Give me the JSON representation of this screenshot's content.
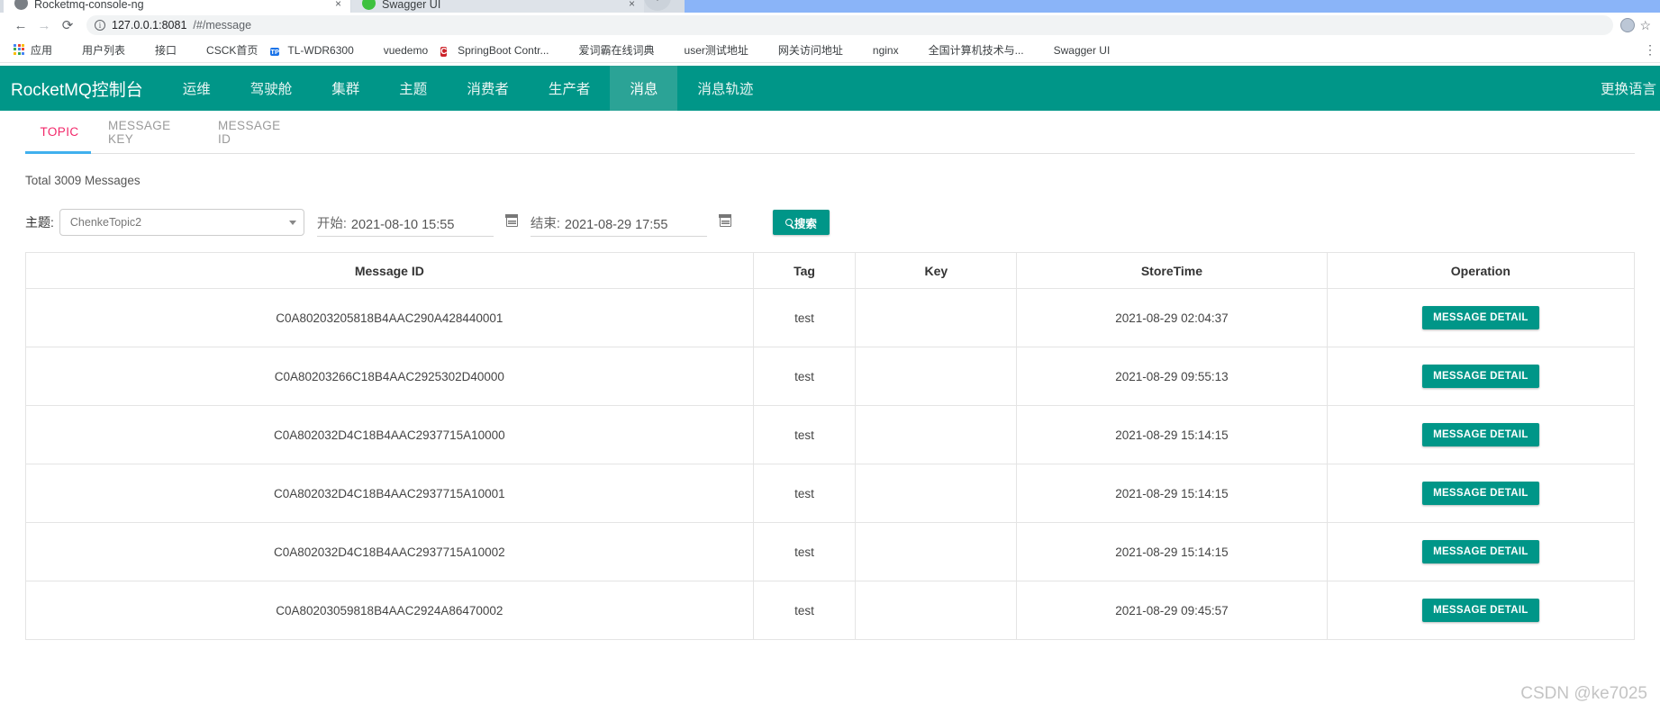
{
  "browser": {
    "tabs": [
      {
        "title": "Rocketmq-console-ng",
        "favicon": "globe-icon",
        "active": false,
        "close_label": "×"
      },
      {
        "title": "Swagger UI",
        "favicon": "swagger-icon",
        "active": true,
        "close_label": "×"
      }
    ],
    "new_tab_label": "+",
    "back_label": "←",
    "forward_label": "→",
    "reload_label": "⟳",
    "address": {
      "host": "127.0.0.1:8081",
      "path": "/#/message",
      "info_icon": "ⓘ"
    },
    "star_label": "☆",
    "bookmarks": [
      {
        "label": "应用",
        "icon": "apps-grid-icon"
      },
      {
        "label": "用户列表",
        "icon": "leaf-icon"
      },
      {
        "label": "接口",
        "icon": "leaf-icon"
      },
      {
        "label": "CSCK首页",
        "icon": "leaf-icon"
      },
      {
        "label": "TL-WDR6300",
        "icon": "tp-icon"
      },
      {
        "label": "vuedemo",
        "icon": "globe-icon"
      },
      {
        "label": "SpringBoot Contr...",
        "icon": "c-icon"
      },
      {
        "label": "爱词霸在线词典",
        "icon": "globe-icon"
      },
      {
        "label": "user测试地址",
        "icon": "leaf-icon"
      },
      {
        "label": "网关访问地址",
        "icon": "globe-icon"
      },
      {
        "label": "nginx",
        "icon": "globe-icon"
      },
      {
        "label": "全国计算机技术与...",
        "icon": "dark-badge-icon"
      },
      {
        "label": "Swagger UI",
        "icon": "swagger-icon"
      }
    ],
    "bookmarks_overflow_label": "⋮"
  },
  "app": {
    "brand": "RocketMQ控制台",
    "nav_items": [
      {
        "label": "运维",
        "active": false
      },
      {
        "label": "驾驶舱",
        "active": false
      },
      {
        "label": "集群",
        "active": false
      },
      {
        "label": "主题",
        "active": false
      },
      {
        "label": "消费者",
        "active": false
      },
      {
        "label": "生产者",
        "active": false
      },
      {
        "label": "消息",
        "active": true
      },
      {
        "label": "消息轨迹",
        "active": false
      }
    ],
    "language_label": "更换语言",
    "accent_color": "#009688",
    "active_tab_color": "#f2286a",
    "underline_color": "#40b0ee"
  },
  "content": {
    "tabs": [
      {
        "label": "TOPIC",
        "active": true
      },
      {
        "label": "MESSAGE KEY",
        "active": false
      },
      {
        "label": "MESSAGE ID",
        "active": false
      }
    ],
    "total_text": "Total 3009 Messages",
    "filters": {
      "topic_label": "主题:",
      "topic_value": "ChenkeTopic2",
      "begin_label": "开始:",
      "begin_value": "2021-08-10 15:55",
      "end_label": "结束:",
      "end_value": "2021-08-29 17:55",
      "search_label": "搜索",
      "search_icon": "magnifier-icon",
      "calendar_icon": "calendar-icon",
      "dropdown_icon": "chevron-down-icon"
    },
    "table": {
      "columns": [
        "Message ID",
        "Tag",
        "Key",
        "StoreTime",
        "Operation"
      ],
      "action_label": "MESSAGE DETAIL",
      "rows": [
        {
          "message_id": "C0A80203205818B4AAC290A428440001",
          "tag": "test",
          "key": "",
          "store_time": "2021-08-29 02:04:37"
        },
        {
          "message_id": "C0A80203266C18B4AAC2925302D40000",
          "tag": "test",
          "key": "",
          "store_time": "2021-08-29 09:55:13"
        },
        {
          "message_id": "C0A802032D4C18B4AAC2937715A10000",
          "tag": "test",
          "key": "",
          "store_time": "2021-08-29 15:14:15"
        },
        {
          "message_id": "C0A802032D4C18B4AAC2937715A10001",
          "tag": "test",
          "key": "",
          "store_time": "2021-08-29 15:14:15"
        },
        {
          "message_id": "C0A802032D4C18B4AAC2937715A10002",
          "tag": "test",
          "key": "",
          "store_time": "2021-08-29 15:14:15"
        },
        {
          "message_id": "C0A80203059818B4AAC2924A86470002",
          "tag": "test",
          "key": "",
          "store_time": "2021-08-29 09:45:57"
        }
      ]
    }
  },
  "watermark": "CSDN @ke7025"
}
